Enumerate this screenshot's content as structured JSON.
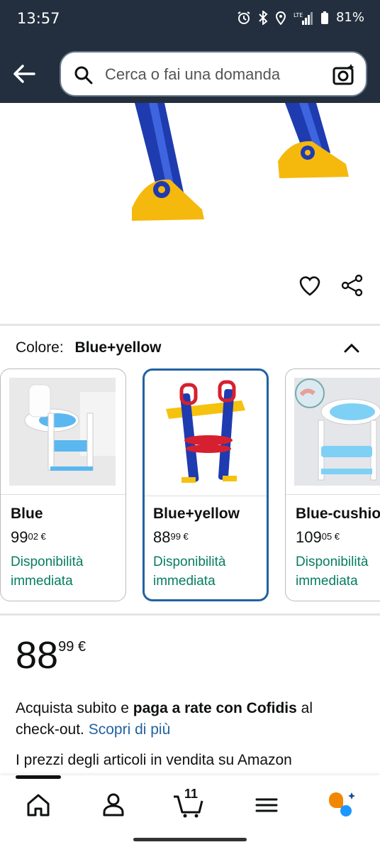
{
  "status": {
    "time": "13:57",
    "battery": "81%"
  },
  "search": {
    "placeholder": "Cerca o fai una domanda"
  },
  "variants": {
    "label": "Colore:",
    "selected": "Blue+yellow",
    "items": [
      {
        "name": "Blue",
        "price_int": "99",
        "price_dec": "02 €",
        "availability": "Disponibilità immediata"
      },
      {
        "name": "Blue+yellow",
        "price_int": "88",
        "price_dec": "99 €",
        "availability": "Disponibilità immediata"
      },
      {
        "name": "Blue-cushion",
        "price_int": "109",
        "price_dec": "05 €",
        "availability": "Disponibilità immediata"
      }
    ]
  },
  "price": {
    "int": "88",
    "dec": "99 €"
  },
  "promo": {
    "text1": "Acquista subito e ",
    "bold": "paga a rate con Cofidis",
    "text2": " al check-out. ",
    "link": "Scopri di più"
  },
  "note": "I prezzi degli articoli in vendita su Amazon",
  "nav": {
    "cart_count": "11"
  },
  "colors": {
    "header": "#232f3e",
    "link": "#2162a1",
    "available": "#067d62",
    "selected_border": "#2162a1"
  }
}
